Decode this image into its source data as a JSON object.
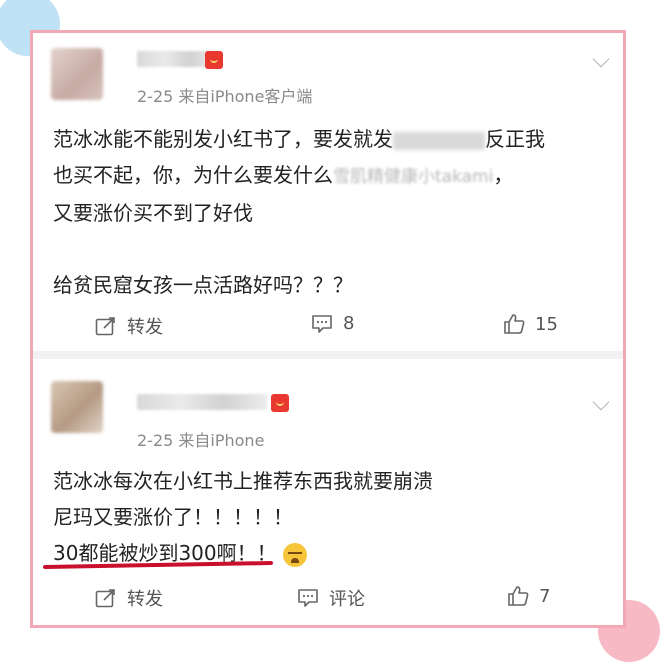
{
  "posts": [
    {
      "date_source": "2-25  来自iPhone客户端",
      "lines": [
        {
          "before": "范冰冰能不能别发小红书了，要发就发",
          "after": "反正我"
        },
        {
          "before": "也买不起，你，为什么要发什么",
          "blurred": "雪肌精健康小takami",
          "after": "，"
        },
        {
          "before": "又要涨价买不到了好伐"
        },
        {
          "before": ""
        },
        {
          "before": "给贫民窟女孩一点活路好吗？？？"
        }
      ],
      "actions": {
        "repost": "转发",
        "comment": "8",
        "like": "15"
      }
    },
    {
      "date_source": "2-25  来自iPhone",
      "lines": [
        {
          "before": "范冰冰每次在小红书上推荐东西我就要崩溃"
        },
        {
          "before": "尼玛又要涨价了！！！！！"
        },
        {
          "before": "30都能被炒到300啊！！"
        }
      ],
      "actions": {
        "repost": "转发",
        "comment": "评论",
        "like": "7"
      }
    }
  ],
  "icons": {
    "repost": "share-icon",
    "comment": "comment-icon",
    "like": "thumb-up-icon",
    "more": "chevron-down-icon",
    "badge": "red-envelope-icon",
    "emoji": "crying-face-emoji"
  },
  "colors": {
    "frame": "#f4a8b6",
    "underline": "#c8102e",
    "divider": "#f2f2f2"
  }
}
